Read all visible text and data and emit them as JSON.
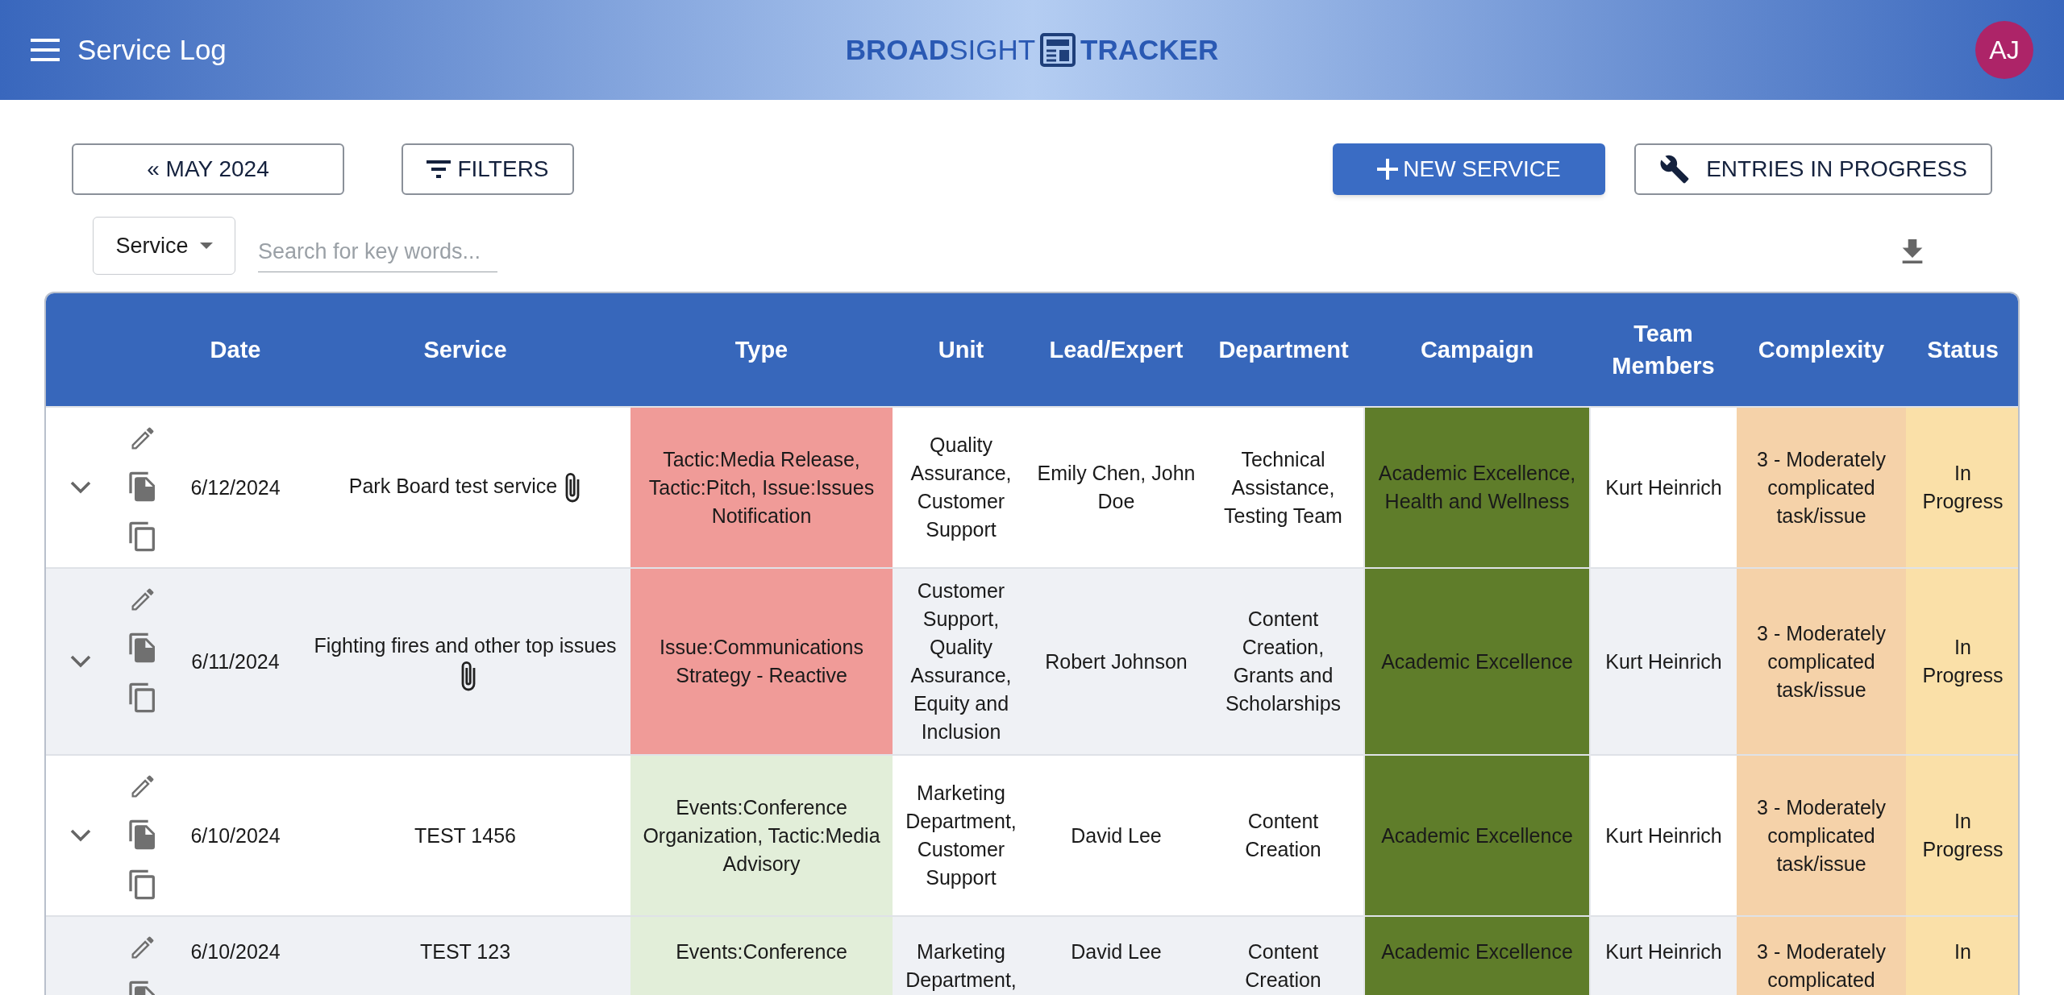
{
  "header": {
    "title": "Service Log",
    "brand": {
      "strong": "BROAD",
      "light": "SIGHT",
      "second": "TRACKER"
    },
    "avatar": "AJ"
  },
  "toolbar": {
    "month_button": "« MAY 2024",
    "filters_button": "FILTERS",
    "new_button": "NEW SERVICE",
    "progress_button": "ENTRIES IN PROGRESS"
  },
  "search": {
    "scope": "Service",
    "placeholder": "Search for key words..."
  },
  "table": {
    "columns": [
      "Date",
      "Service",
      "Type",
      "Unit",
      "Lead/Expert",
      "Department",
      "Campaign",
      "Team Members",
      "Complexity",
      "Status"
    ],
    "rows": [
      {
        "date": "6/12/2024",
        "service": "Park Board test service",
        "attachment": true,
        "type": {
          "text": "Tactic:Media Release, Tactic:Pitch, Issue:Issues Notification",
          "color": "#f09b98"
        },
        "unit": "Quality Assurance, Customer Support",
        "lead": "Emily Chen, John Doe",
        "department": "Technical Assistance, Testing Team",
        "campaign": "Academic Excellence, Health and Wellness",
        "team": "Kurt Heinrich",
        "complexity": "3 - Moderately complicated task/issue",
        "status": "In Progress"
      },
      {
        "date": "6/11/2024",
        "service": "Fighting fires and other top issues",
        "attachment": true,
        "type": {
          "text": "Issue:Communications Strategy - Reactive",
          "color": "#f09b98"
        },
        "unit": "Customer Support, Quality Assurance, Equity and Inclusion",
        "lead": "Robert Johnson",
        "department": "Content Creation, Grants and Scholarships",
        "campaign": "Academic Excellence",
        "team": "Kurt Heinrich",
        "complexity": "3 - Moderately complicated task/issue",
        "status": "In Progress"
      },
      {
        "date": "6/10/2024",
        "service": "TEST 1456",
        "attachment": false,
        "type": {
          "text": "Events:Conference Organization, Tactic:Media Advisory",
          "color": "#e2eed9"
        },
        "unit": "Marketing Department, Customer Support",
        "lead": "David Lee",
        "department": "Content Creation",
        "campaign": "Academic Excellence",
        "team": "Kurt Heinrich",
        "complexity": "3 - Moderately complicated task/issue",
        "status": "In Progress"
      },
      {
        "date": "6/10/2024",
        "service": "TEST 123",
        "attachment": false,
        "type": {
          "text": "Events:Conference",
          "color": "#e2eed9"
        },
        "unit": "Marketing Department,",
        "lead": "David Lee",
        "department": "Content Creation",
        "campaign": "Academic Excellence",
        "team": "Kurt Heinrich",
        "complexity": "3 - Moderately complicated",
        "status": "In"
      }
    ]
  }
}
